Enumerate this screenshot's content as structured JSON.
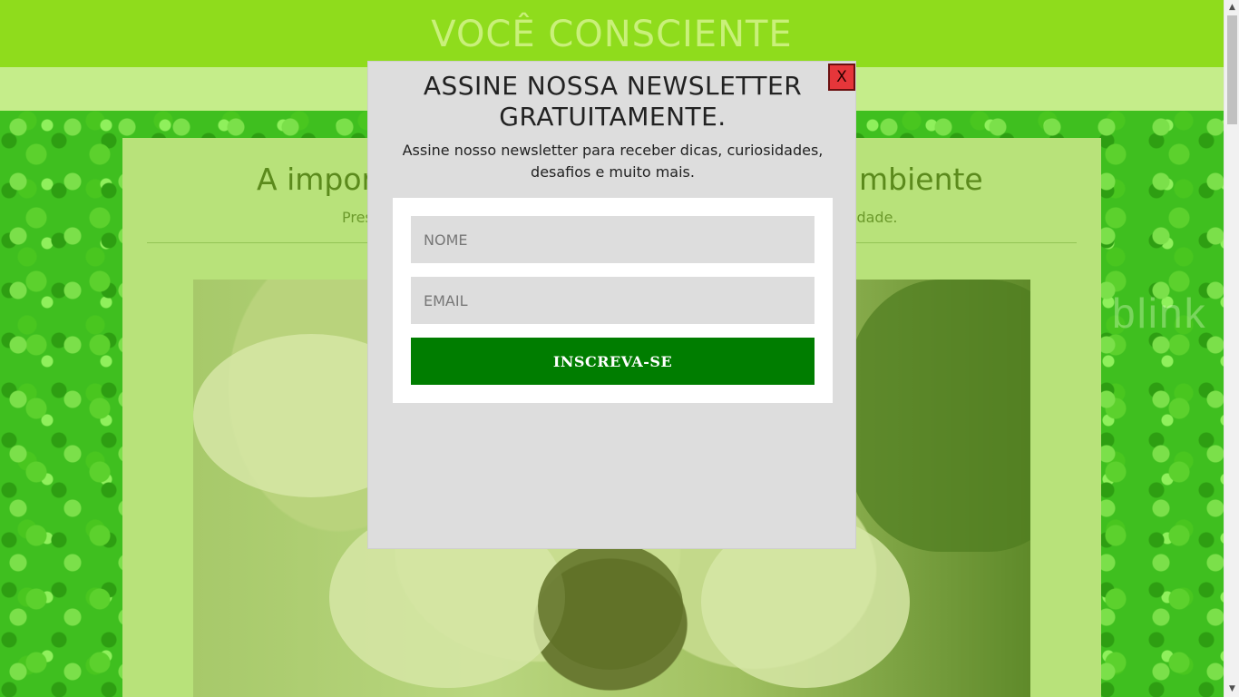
{
  "header": {
    "site_title": "VOCÊ CONSCIENTE"
  },
  "article": {
    "title_left": "A impor",
    "title_right": "mbiente",
    "subtitle_left": "Pres",
    "subtitle_right": "idade."
  },
  "background": {
    "watermark": "blink"
  },
  "newsletter": {
    "title": "ASSINE NOSSA NEWSLETTER GRATUITAMENTE.",
    "description": "Assine nosso newsletter para receber dicas, curiosidades, desafios e muito mais.",
    "close_label": "X",
    "name_placeholder": "NOME",
    "email_placeholder": "EMAIL",
    "submit_label": "INSCREVA-SE"
  },
  "colors": {
    "header": "#8fdc1c",
    "nav": "#c5ed8a",
    "article_bg": "#b8e27a",
    "modal_bg": "#dddddd",
    "close_button": "#e6363a",
    "submit_button": "#007d00"
  },
  "icons": {
    "scroll_up": "triangle-up-icon",
    "scroll_down": "triangle-down-icon"
  }
}
